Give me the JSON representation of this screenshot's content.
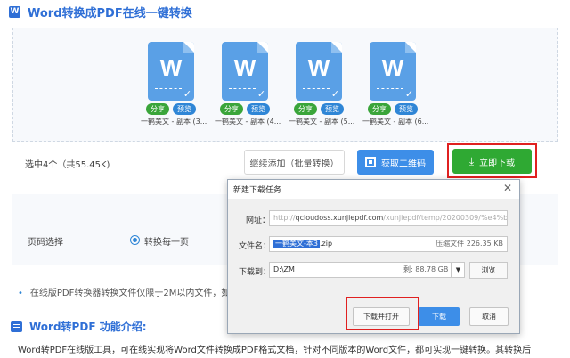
{
  "page": {
    "title": "Word转换成PDF在线一键转换",
    "title_icon": "w-doc-icon"
  },
  "files": [
    {
      "name": "一鹤美文 - 副本 (3...",
      "share": "分享",
      "preview": "预览",
      "glyph": "W"
    },
    {
      "name": "一鹤美文 - 副本 (4...",
      "share": "分享",
      "preview": "预览",
      "glyph": "W"
    },
    {
      "name": "一鹤美文 - 副本 (5...",
      "share": "分享",
      "preview": "预览",
      "glyph": "W"
    },
    {
      "name": "一鹤美文 - 副本 (6...",
      "share": "分享",
      "preview": "预览",
      "glyph": "W"
    }
  ],
  "actions": {
    "selected": "选中4个（共55.45K)",
    "continue_add": "继续添加（批量转换）",
    "get_qr": "获取二维码",
    "download_now": "立即下载"
  },
  "options": {
    "page_select_label": "页码选择",
    "mode": "转换每一页"
  },
  "notice": "在线版PDF转换器转换文件仅限于2M以内文件，如",
  "section": {
    "title": "Word转PDF 功能介绍:",
    "intro": "Word转PDF在线版工具，可在线实现将Word文件转换成PDF格式文档，针对不同版本的Word文件，都可实现一键转换。其转换后"
  },
  "dialog": {
    "title": "新建下载任务",
    "close": "✕",
    "url_label": "网址：",
    "url_prefix": "http://",
    "url_host": "qcloudoss.xunjiepdf.com",
    "url_rest": "/xunjiepdf/temp/20200309/%e4%b8%8",
    "filename_label": "文件名：",
    "filename_selected": "一鹤美文-本3",
    "filename_ext": ".zip",
    "compressed_size": "压缩文件 226.35 KB",
    "download_to_label": "下载到：",
    "path": "D:\\ZM",
    "free_space": "剩: 88.78 GB",
    "dropdown": "▼",
    "browse": "浏览",
    "download_and_open": "下载并打开",
    "download": "下载",
    "cancel": "取消"
  },
  "colors": {
    "brand_blue": "#2f6fd6",
    "download_green": "#2fa933",
    "highlight_red": "#e02020"
  }
}
